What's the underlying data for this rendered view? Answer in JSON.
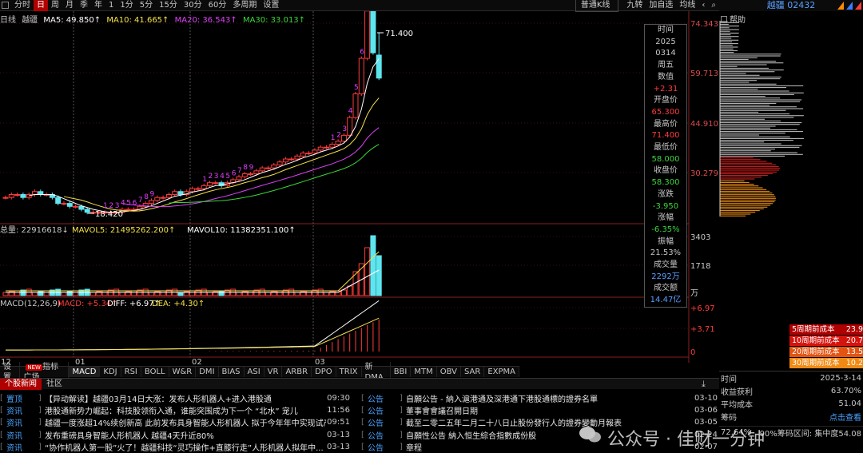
{
  "periods": [
    "分时",
    "日",
    "周",
    "月",
    "季",
    "年",
    "1",
    "1分",
    "5分",
    "15分",
    "30分",
    "60分",
    "多周期",
    "设置"
  ],
  "active_period": "日",
  "toolbar_right": {
    "kline_type": "普通K线",
    "nine_turn": "九转",
    "add_watch": "加自选",
    "ma_line": "均线"
  },
  "stock": {
    "name": "越疆",
    "code": "02432"
  },
  "ma_line": {
    "prefix": "日线",
    "name": "越疆",
    "ma5": "MA5: 49.850↑",
    "ma10": "MA10: 41.665↑",
    "ma20": "MA20: 36.543↑",
    "ma30": "MA30: 33.013↑"
  },
  "volume_line": {
    "total": "总量: 22916618↓",
    "mavol5": "MAVOL5: 21495262.200↑",
    "mavol10": "MAVOL10: 11382351.100↑"
  },
  "macd_line": {
    "name": "MACD(12,26,9)",
    "macd": "MACD: +5.34↑",
    "diff": "DIFF: +6.97↑",
    "dea": "DEA: +4.30↑"
  },
  "price_axis": [
    "74.343",
    "59.713",
    "44.910",
    "30.279"
  ],
  "volume_axis": [
    "3403",
    "1718"
  ],
  "volume_unit": "万",
  "macd_axis": [
    "+6.97",
    "+3.71",
    "0"
  ],
  "date_axis": [
    "12",
    "01",
    "02",
    "03"
  ],
  "annotations": {
    "high": "71.400",
    "low": "18.420"
  },
  "nine_turn_marks": [
    "1",
    "2",
    "3",
    "4",
    "5",
    "6",
    "7",
    "8",
    "9"
  ],
  "info_box": [
    {
      "label": "时间",
      "value": "2025"
    },
    {
      "label": "",
      "value": "0314"
    },
    {
      "label": "周五",
      "value": ""
    },
    {
      "label": "数值",
      "value": "+2.31"
    },
    {
      "label": "开盘价",
      "value": "65.300"
    },
    {
      "label": "最高价",
      "value": "71.400"
    },
    {
      "label": "最低价",
      "value": "58.000"
    },
    {
      "label": "收盘价",
      "value": "58.300"
    },
    {
      "label": "涨跌",
      "value": "-3.950"
    },
    {
      "label": "涨幅",
      "value": "-6.35%"
    },
    {
      "label": "振幅",
      "value": "21.53%"
    },
    {
      "label": "成交量",
      "value": "2292万"
    },
    {
      "label": "成交额",
      "value": "14.47亿"
    }
  ],
  "indicator_tabs": [
    "设置",
    "指标广场",
    "MACD",
    "KDJ",
    "RSI",
    "BOLL",
    "W&R",
    "DMI",
    "BIAS",
    "ASI",
    "VR",
    "ARBR",
    "DPO",
    "TRIX",
    "新DMA",
    "BBI",
    "MTM",
    "OBV",
    "SAR",
    "EXPMA"
  ],
  "new_badge": "NEW",
  "active_tab": "MACD",
  "news_tabs": [
    "个股新闻",
    "社区"
  ],
  "news_left": [
    {
      "tag": "置顶",
      "title": "【异动解读】越疆03月14日大涨：发布人形机器人+进入港股通",
      "time": "09:30"
    },
    {
      "tag": "资讯",
      "title": "港股通新势力崛起：科技股领衔入通，谁能突围成为下一个 “北水” 宠儿",
      "time": "11:56"
    },
    {
      "tag": "资讯",
      "title": "越疆一度涨超14%续创新高 此前发布具身智能人形机器人 拟于今年年中实现试产",
      "time": "09:51"
    },
    {
      "tag": "资讯",
      "title": "发布重磅具身智能人形机器人 越疆4天升近80%",
      "time": "03-13"
    },
    {
      "tag": "资讯",
      "title": "“协作机器人第一股”火了！越疆科技“灵巧操作+直膝行走”人形机器人拟年中...",
      "time": "03-13"
    }
  ],
  "news_right": [
    {
      "tag": "公告",
      "title": "自願公告 - 納入滬港通及深港通下港股通標的證券名單",
      "time": "03-10"
    },
    {
      "tag": "公告",
      "title": "董事會會議召開日期",
      "time": "03-06"
    },
    {
      "tag": "公告",
      "title": "截至二零二五年二月二十八日止股份發行人的證券變動月報表",
      "time": "03-05"
    },
    {
      "tag": "公告",
      "title": "自願性公告 納入恒生綜合指數成份股",
      "time": "02-24"
    },
    {
      "tag": "公告",
      "title": "章程",
      "time": "02-07"
    }
  ],
  "right_panel": {
    "help": "帮助",
    "cost_rows": [
      {
        "label": "5周期前成本",
        "value": "23.9"
      },
      {
        "label": "10周期前成本",
        "value": "20.7"
      },
      {
        "label": "20周期前成本",
        "value": "13.5"
      },
      {
        "label": "30周期前成本",
        "value": "10.2"
      }
    ],
    "time_label": "时间",
    "time_value": "2025-3-14",
    "profit_label": "收益获利",
    "profit_value": "63.70%",
    "avg_cost_label": "平均成本",
    "avg_cost_value": "51.04",
    "chip_label": "筹码",
    "chip_value": "点击查看",
    "pct_value": "72.64%",
    "range_label": "90%筹码区间:",
    "concentration_label": "集中度54.08"
  },
  "watermark": "公众号 · 佳财一分钟",
  "colors": {
    "up": "#ff3b3b",
    "down": "#5ee6f0",
    "ma5": "#ffffff",
    "ma10": "#f5e14a",
    "ma20": "#e040fb",
    "ma30": "#3ad63a",
    "accent": "#b00000"
  }
}
